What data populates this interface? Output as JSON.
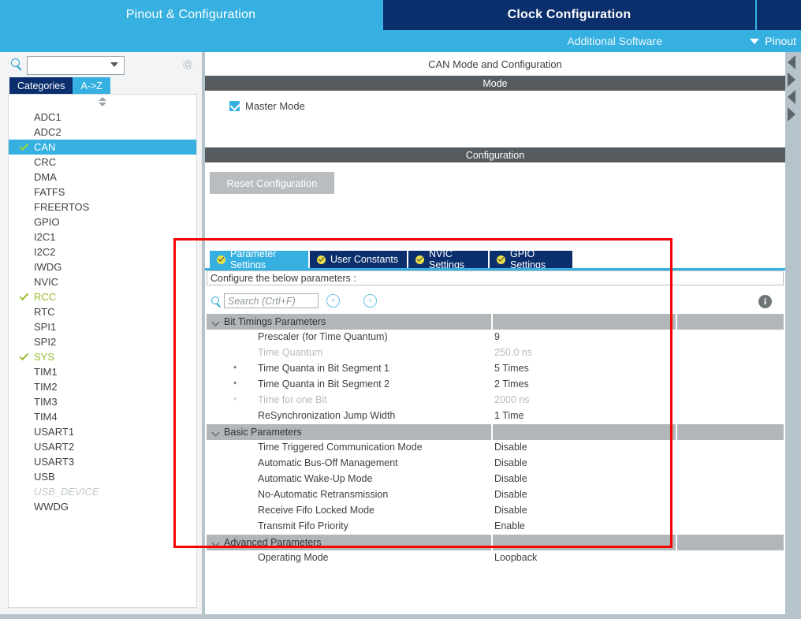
{
  "topbar": {
    "tabs": [
      {
        "label": "Pinout & Configuration",
        "active": true
      },
      {
        "label": "Clock Configuration",
        "active": false
      }
    ],
    "additional_software": "Additional Software",
    "pinout_menu": "Pinout",
    "accent_light": "#35b0e0",
    "accent_dark": "#0b2f6d"
  },
  "sidebar": {
    "search_placeholder": "",
    "gear_icon": "gear-icon",
    "category_tabs": [
      {
        "label": "Categories",
        "active": false
      },
      {
        "label": "A->Z",
        "active": true
      }
    ],
    "items": [
      {
        "label": "ADC1",
        "state": "normal",
        "checked": false
      },
      {
        "label": "ADC2",
        "state": "normal",
        "checked": false
      },
      {
        "label": "CAN",
        "state": "selected",
        "checked": true
      },
      {
        "label": "CRC",
        "state": "normal",
        "checked": false
      },
      {
        "label": "DMA",
        "state": "normal",
        "checked": false
      },
      {
        "label": "FATFS",
        "state": "normal",
        "checked": false
      },
      {
        "label": "FREERTOS",
        "state": "normal",
        "checked": false
      },
      {
        "label": "GPIO",
        "state": "normal",
        "checked": false
      },
      {
        "label": "I2C1",
        "state": "normal",
        "checked": false
      },
      {
        "label": "I2C2",
        "state": "normal",
        "checked": false
      },
      {
        "label": "IWDG",
        "state": "normal",
        "checked": false
      },
      {
        "label": "NVIC",
        "state": "normal",
        "checked": false
      },
      {
        "label": "RCC",
        "state": "configured",
        "checked": true
      },
      {
        "label": "RTC",
        "state": "normal",
        "checked": false
      },
      {
        "label": "SPI1",
        "state": "normal",
        "checked": false
      },
      {
        "label": "SPI2",
        "state": "normal",
        "checked": false
      },
      {
        "label": "SYS",
        "state": "configured",
        "checked": true
      },
      {
        "label": "TIM1",
        "state": "normal",
        "checked": false
      },
      {
        "label": "TIM2",
        "state": "normal",
        "checked": false
      },
      {
        "label": "TIM3",
        "state": "normal",
        "checked": false
      },
      {
        "label": "TIM4",
        "state": "normal",
        "checked": false
      },
      {
        "label": "USART1",
        "state": "normal",
        "checked": false
      },
      {
        "label": "USART2",
        "state": "normal",
        "checked": false
      },
      {
        "label": "USART3",
        "state": "normal",
        "checked": false
      },
      {
        "label": "USB",
        "state": "normal",
        "checked": false
      },
      {
        "label": "USB_DEVICE",
        "state": "disabled",
        "checked": false
      },
      {
        "label": "WWDG",
        "state": "normal",
        "checked": false
      }
    ]
  },
  "main": {
    "title": "CAN Mode and Configuration",
    "mode_band": "Mode",
    "mode_checkbox": {
      "label": "Master Mode",
      "checked": true
    },
    "configuration_band": "Configuration",
    "reset_button": "Reset Configuration",
    "tabs": [
      {
        "label": "Parameter Settings",
        "active": true
      },
      {
        "label": "User Constants",
        "active": false
      },
      {
        "label": "NVIC Settings",
        "active": false
      },
      {
        "label": "GPIO Settings",
        "active": false
      }
    ],
    "configure_hint": "Configure the below parameters :",
    "tree_search_placeholder": "Search (Crtl+F)",
    "nav_prev": "‹",
    "nav_next": "›",
    "info_icon": "info-icon",
    "groups": [
      {
        "title": "Bit Timings Parameters",
        "rows": [
          {
            "star": false,
            "label": "Prescaler (for Time Quantum)",
            "value": "9",
            "muted": false
          },
          {
            "star": false,
            "label": "Time Quantum",
            "value": "250.0 ns",
            "muted": true
          },
          {
            "star": true,
            "label": "Time Quanta in Bit Segment 1",
            "value": "5 Times",
            "muted": false
          },
          {
            "star": true,
            "label": "Time Quanta in Bit Segment 2",
            "value": "2 Times",
            "muted": false
          },
          {
            "star": true,
            "label": "Time for one Bit",
            "value": "2000 ns",
            "muted": true
          },
          {
            "star": false,
            "label": "ReSynchronization Jump Width",
            "value": "1 Time",
            "muted": false
          }
        ]
      },
      {
        "title": "Basic Parameters",
        "rows": [
          {
            "star": false,
            "label": "Time Triggered Communication Mode",
            "value": "Disable",
            "muted": false
          },
          {
            "star": false,
            "label": "Automatic Bus-Off Management",
            "value": "Disable",
            "muted": false
          },
          {
            "star": false,
            "label": "Automatic Wake-Up Mode",
            "value": "Disable",
            "muted": false
          },
          {
            "star": false,
            "label": "No-Automatic Retransmission",
            "value": "Disable",
            "muted": false
          },
          {
            "star": false,
            "label": "Receive Fifo Locked Mode",
            "value": "Disable",
            "muted": false
          },
          {
            "star": false,
            "label": "Transmit Fifo Priority",
            "value": "Enable",
            "muted": false
          }
        ]
      },
      {
        "title": "Advanced Parameters",
        "rows": [
          {
            "star": false,
            "label": "Operating Mode",
            "value": "Loopback",
            "muted": false
          }
        ]
      }
    ]
  },
  "annotation": {
    "color": "#fa0000",
    "shape": "rectangle"
  }
}
